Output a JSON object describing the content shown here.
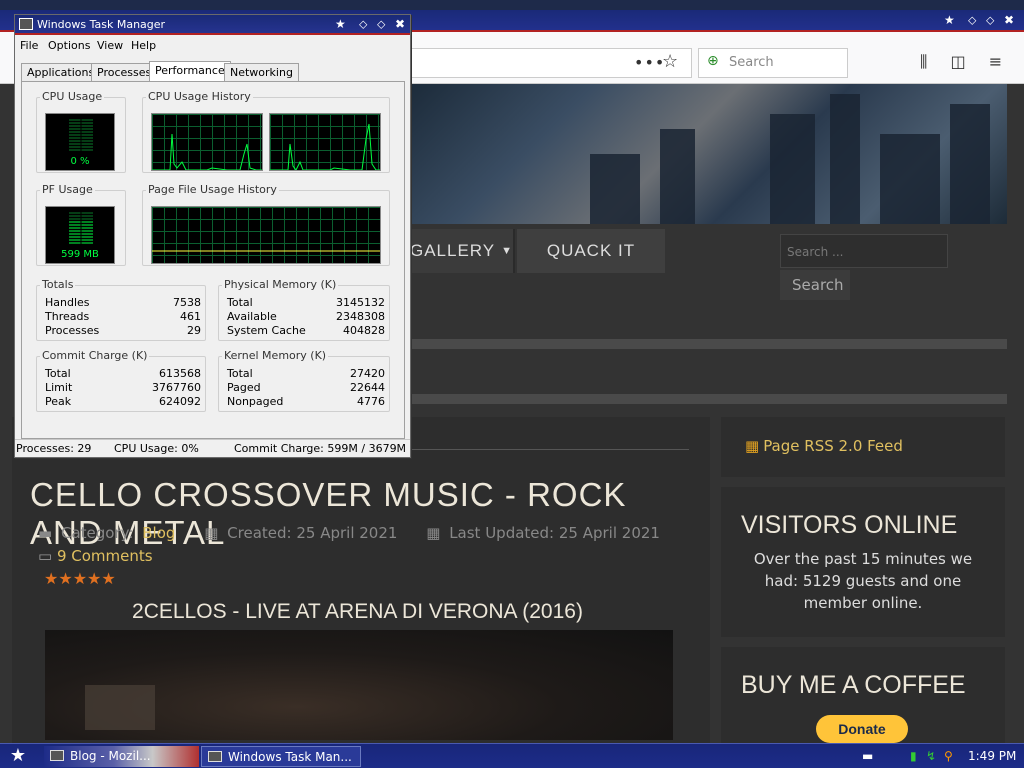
{
  "browser": {
    "search_placeholder": "Search",
    "dots": "•••",
    "star": "☆"
  },
  "page": {
    "nav": {
      "gallery": "GALLERY",
      "quack": "QUACK IT"
    },
    "search_placeholder": "Search ...",
    "search_button": "Search",
    "article": {
      "title": "CELLO CROSSOVER MUSIC - ROCK AND METAL",
      "category_label": "Category:",
      "category": "Blog",
      "created": "Created: 25 April 2021",
      "updated": "Last Updated: 25 April 2021",
      "comments": "9 Comments",
      "rating": "★★★★★",
      "subtitle": "2CELLOS - LIVE AT ARENA DI VERONA (2016)"
    },
    "sidebar": {
      "rss": "Page RSS 2.0 Feed",
      "visitors_title": "VISITORS ONLINE",
      "visitors_text": "Over the past 15 minutes we had: 5129 guests and one member online.",
      "coffee_title": "BUY ME A COFFEE",
      "donate": "Donate"
    }
  },
  "taskmanager": {
    "title": "Windows Task Manager",
    "menu": [
      "File",
      "Options",
      "View",
      "Help"
    ],
    "tabs": [
      "Applications",
      "Processes",
      "Performance",
      "Networking"
    ],
    "active_tab": "Performance",
    "cpu_usage_label": "CPU Usage",
    "cpu_usage_value": "0 %",
    "cpu_history_label": "CPU Usage History",
    "pf_usage_label": "PF Usage",
    "pf_usage_value": "599 MB",
    "pf_history_label": "Page File Usage History",
    "totals": {
      "label": "Totals",
      "rows": [
        [
          "Handles",
          "7538"
        ],
        [
          "Threads",
          "461"
        ],
        [
          "Processes",
          "29"
        ]
      ]
    },
    "physical": {
      "label": "Physical Memory (K)",
      "rows": [
        [
          "Total",
          "3145132"
        ],
        [
          "Available",
          "2348308"
        ],
        [
          "System Cache",
          "404828"
        ]
      ]
    },
    "commit": {
      "label": "Commit Charge (K)",
      "rows": [
        [
          "Total",
          "613568"
        ],
        [
          "Limit",
          "3767760"
        ],
        [
          "Peak",
          "624092"
        ]
      ]
    },
    "kernel": {
      "label": "Kernel Memory (K)",
      "rows": [
        [
          "Total",
          "27420"
        ],
        [
          "Paged",
          "22644"
        ],
        [
          "Nonpaged",
          "4776"
        ]
      ]
    },
    "status": {
      "processes": "Processes: 29",
      "cpu": "CPU Usage: 0%",
      "commit": "Commit Charge: 599M / 3679M"
    }
  },
  "taskbar": {
    "items": [
      "Blog - Mozil...",
      "Windows Task Man..."
    ],
    "clock": "1:49 PM"
  },
  "colors": {
    "accent_gold": "#e0c060",
    "graph_green": "#00ff40",
    "titlebar_blue": "#1a2a78"
  }
}
